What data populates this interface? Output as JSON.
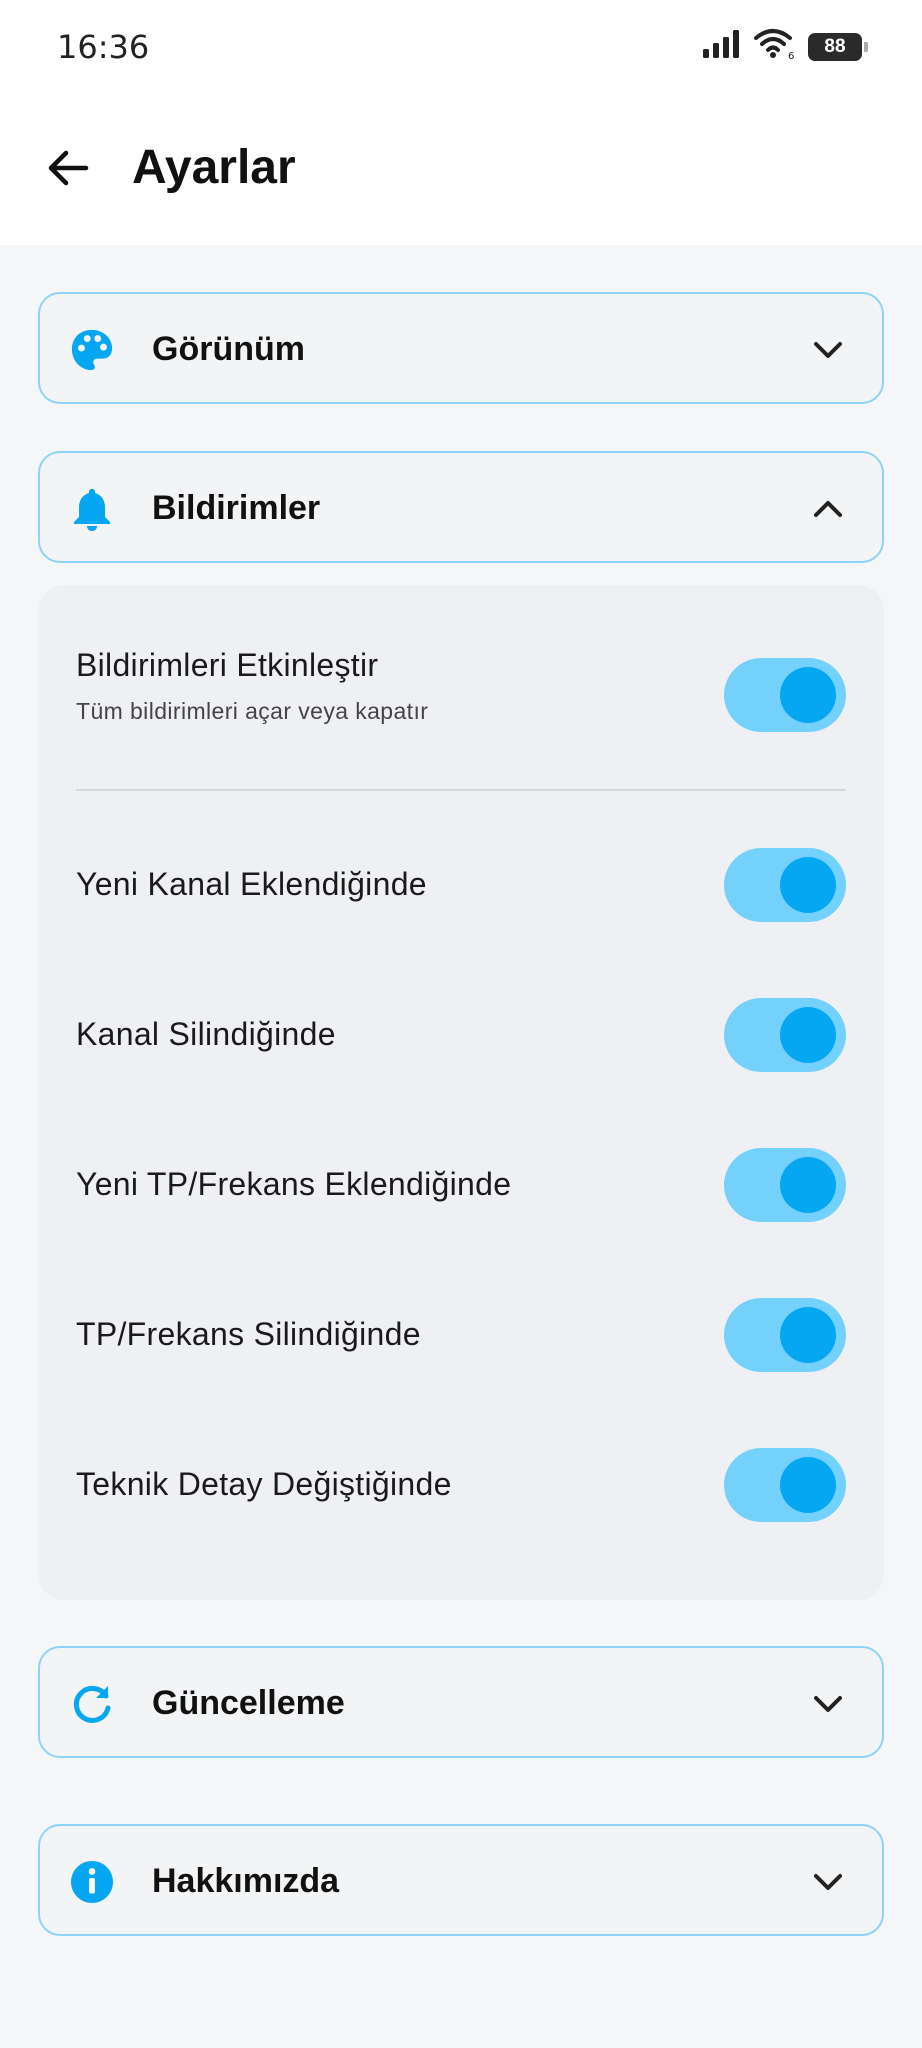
{
  "status_bar": {
    "time": "16:36",
    "battery": "88",
    "icons": [
      "signal-icon",
      "wifi-icon",
      "battery-icon"
    ]
  },
  "app_bar": {
    "title": "Ayarlar",
    "back_icon": "arrow-left-icon"
  },
  "colors": {
    "accent": "#05a6f2",
    "toggle_track": "#74d1fb",
    "card_border": "#8ed3f5",
    "background": "#f5f6f8"
  },
  "sections": {
    "appearance": {
      "label": "Görünüm",
      "icon": "palette-icon",
      "expanded": false
    },
    "notifications": {
      "label": "Bildirimler",
      "icon": "bell-icon",
      "expanded": true
    },
    "updates": {
      "label": "Güncelleme",
      "icon": "refresh-icon",
      "expanded": false
    },
    "about": {
      "label": "Hakkımızda",
      "icon": "info-icon",
      "expanded": false
    }
  },
  "notifications": {
    "master": {
      "label": "Bildirimleri Etkinleştir",
      "description": "Tüm bildirimleri açar veya kapatır",
      "enabled": true
    },
    "items": [
      {
        "label": "Yeni Kanal Eklendiğinde",
        "enabled": true
      },
      {
        "label": "Kanal Silindiğinde",
        "enabled": true
      },
      {
        "label": "Yeni TP/Frekans Eklendiğinde",
        "enabled": true
      },
      {
        "label": "TP/Frekans Silindiğinde",
        "enabled": true
      },
      {
        "label": "Teknik Detay Değiştiğinde",
        "enabled": true
      }
    ]
  }
}
